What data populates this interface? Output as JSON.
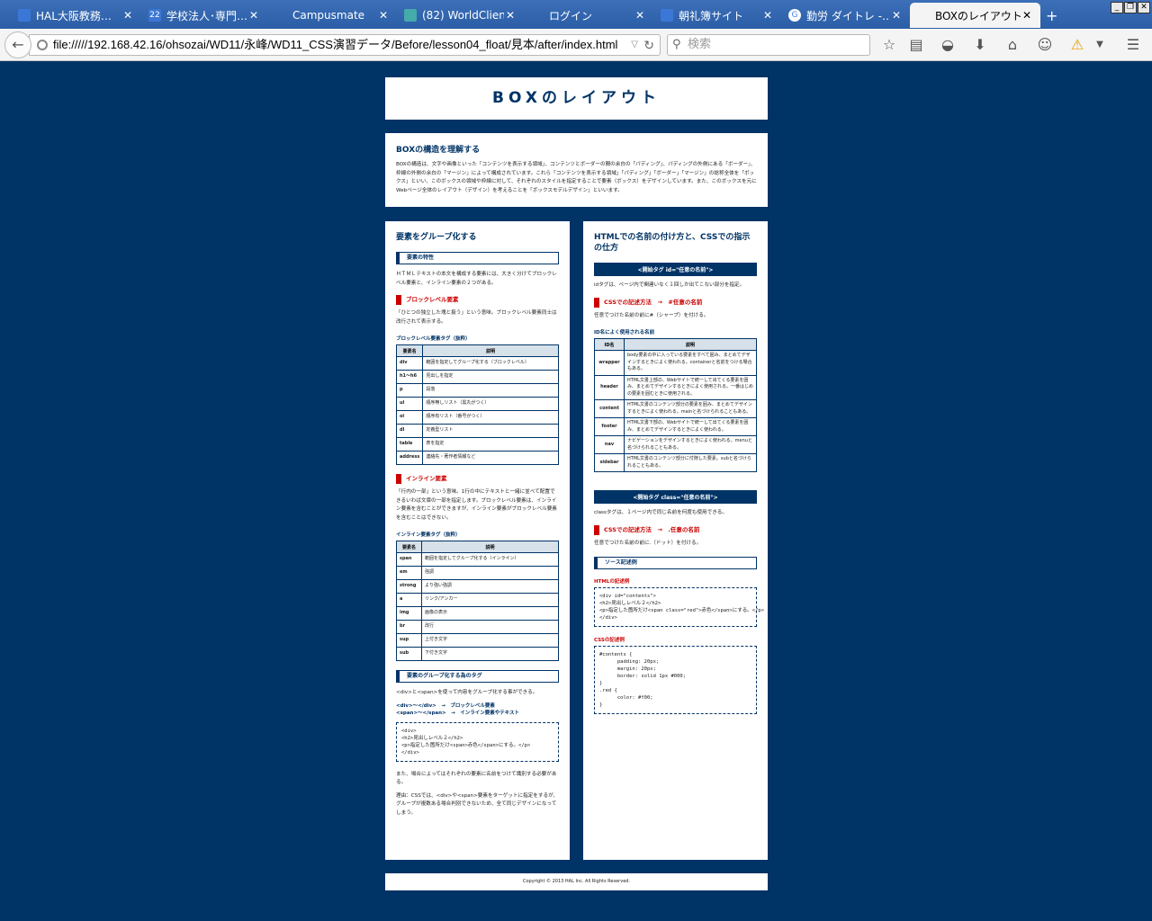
{
  "tabs": [
    {
      "title": "HAL大阪教務…",
      "color": "#3b77d6",
      "icon": "grid-icon"
    },
    {
      "title": "学校法人･専門…",
      "color": "#3b77d6",
      "icon": "calendar-icon",
      "icontext": "22"
    },
    {
      "title": "Campusmate",
      "color": "",
      "icon": "blank-icon"
    },
    {
      "title": "(82) WorldClien…",
      "color": "#4aa",
      "icon": "globe-icon"
    },
    {
      "title": "ログイン",
      "color": "",
      "icon": "blank-icon"
    },
    {
      "title": "朝礼簿サイト",
      "color": "#3b77d6",
      "icon": "grid-icon"
    },
    {
      "title": "勤労 ダイトレ -…",
      "color": "#fff",
      "icon": "google-icon"
    },
    {
      "title": "BOXのレイアウト",
      "color": "",
      "icon": "blank-icon"
    }
  ],
  "url": "file://///192.168.42.16/ohsozai/WD11/永峰/WD11_CSS演習データ/Before/lesson04_float/見本/after/index.html",
  "search_placeholder": "検索",
  "page": {
    "title": "BOXのレイアウト",
    "intro": {
      "heading": "BOXの構造を理解する",
      "text": "BOXの構造は、文字や画像といった「コンテンツを表示する領域」、コンテンツとボーダーの間の余白の「パディング」、パディングの外側にある「ボーダー」、枠線の外側の余白の「マージン」によって構成されています。これら「コンテンツを表示する領域」「パディング」「ボーダー」「マージン」の総称全体を「ボックス」といい、このボックスの領域や枠線に対して、それぞれのスタイルを指定することで要素（ボックス）をデザインしています。また、このボックスを元にWebページ全体のレイアウト（デザイン）を考えることを「ボックスモデルデザイン」といいます。"
    },
    "left": {
      "heading": "要素をグループ化する",
      "sec1": "要素の特性",
      "sec1_text": "ＨＴＭＬテキストの本文を構成する要素には、大きく分けてブロックレベル要素と、インライン要素の２つがある。",
      "block_heading": "ブロックレベル要素",
      "block_text": "「ひとつの独立した塊と扱う」という意味。ブロックレベル要素同士は改行されて表示する。",
      "block_table_title": "ブロックレベル要素タグ（抜粋）",
      "th1": "要素名",
      "th2": "説明",
      "block_rows": [
        [
          "div",
          "範囲を指定してグループ化する（ブロックレベル）"
        ],
        [
          "h1～h6",
          "見出しを指定"
        ],
        [
          "p",
          "段落"
        ],
        [
          "ul",
          "順序無しリスト（黒丸がつく）"
        ],
        [
          "ol",
          "順序有リスト（番号がつく）"
        ],
        [
          "dl",
          "定義型リスト"
        ],
        [
          "table",
          "表を指定"
        ],
        [
          "address",
          "連絡先・著作者情報など"
        ]
      ],
      "inline_heading": "インライン要素",
      "inline_text": "「行内の一部」という意味。1行の中にテキストと一緒に並べて配置できるいわば文章の一部を指定します。ブロックレベル要素は、インライン要素を含むことができますが、インライン要素がブロックレベル要素を含むことはできない。",
      "inline_table_title": "インライン要素タグ（抜粋）",
      "inline_rows": [
        [
          "span",
          "範囲を指定してグループ化する（インライン）"
        ],
        [
          "em",
          "強調"
        ],
        [
          "strong",
          "より強い強調"
        ],
        [
          "a",
          "リンク/アンカー"
        ],
        [
          "img",
          "画像の表示"
        ],
        [
          "br",
          "改行"
        ],
        [
          "sup",
          "上付き文字"
        ],
        [
          "sub",
          "下付き文字"
        ]
      ],
      "sec2": "要素のグループ化する為のタグ",
      "sec2_text": "<div>と<span>を使って内容をグループ化する事ができる。",
      "tag1": "<div>～</div>　→　ブロックレベル要素",
      "tag2": "<span>～</span>　→　インライン要素やテキスト",
      "code": "<div>\n<h2>見出しレベル２</h2>\n<p>指定した箇所だけ<span>赤色</span>にする。</p>\n</div>",
      "note1": "また、場合によってはそれぞれの要素に名前をつけて識別する必要がある。",
      "note2": "理由：CSSでは、<div>や<span>要素をターゲットに指定をするが、グループが複数ある場合判別できないため、全て同じデザインになってしまう。"
    },
    "right": {
      "heading": "HTMLでの名前の付け方と、CSSでの指示の仕方",
      "bar1": "<開始タグ id=\"任意の名前\">",
      "id_text": "idタグは、ページ内で関連いなく１回しか出てこない部分を指定。",
      "id_css": "CSSでの記述方法　→　#任意の名前",
      "id_css_text": "任意でつけた名前の前に#（シャープ）を付ける。",
      "id_table_title": "ID名によく使用される名前",
      "th1": "ID名",
      "th2": "説明",
      "id_rows": [
        [
          "wrapper",
          "body要素の中に入っている要素をすべて囲み、まとめてデザインするときによく使われる。containerと名前をつける場合もある。"
        ],
        [
          "header",
          "HTML文書上部の、Webサイトで統一して出てくる要素を囲み、まとめてデザインするときによく使用される。一番はじめの要素を囲むときに使用される。"
        ],
        [
          "content",
          "HTML文書のコンテンツ部分の要素を囲み、まとめてデザインするときによく使われる。mainと名づけられることもある。"
        ],
        [
          "footer",
          "HTML文書下部の、Webサイトで統一して出てくる要素を囲み、まとめてデザインするときによく使われる。"
        ],
        [
          "nav",
          "ナビゲーションをデザインするときによく使われる。menuと名づけられることもある。"
        ],
        [
          "sidebar",
          "HTML文書のコンテンツ部分に付随した要素。subと名づけられることもある。"
        ]
      ],
      "bar2": "<開始タグ class=\"任意の名前\">",
      "class_text": "classタグは、１ページ内で同じ名前を何度も使用できる。",
      "class_css": "CSSでの記述方法　→　.任意の名前",
      "class_css_text": "任意でつけた名前の前に.（ドット）を付ける。",
      "sec": "ソース記述例",
      "html_label": "HTMLの記述例",
      "html_code": "<div id=\"contents\">\n<h2>見出しレベル２</h2>\n<p>指定した箇所だけ<span class=\"red\">赤色</span>にする。</p>\n</div>",
      "css_label": "CSSの記述例",
      "css_code": "#contents {\n      padding: 20px;\n      margin: 20px;\n      border: solid 1px #000;\n}\n.red {\n      color: #f00;\n}"
    },
    "footer": "Copyright © 2013 HAL Inc. All Rights Reserved."
  }
}
